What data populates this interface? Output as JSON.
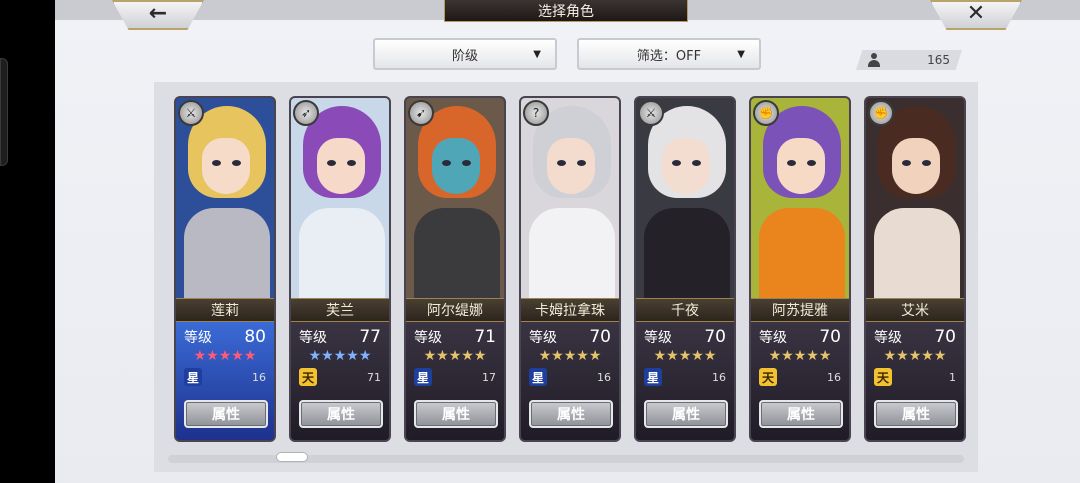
{
  "header": {
    "title": "选择角色",
    "back_icon": "←",
    "close_icon": "✕"
  },
  "filters": {
    "rank_label": "阶级",
    "filter_label": "筛选：OFF",
    "caret": "▼"
  },
  "roster_count": "165",
  "characters": [
    {
      "name": "莲莉",
      "level_label": "等级",
      "level": "80",
      "stars": "★★★★★",
      "star_color": "#ff5a78",
      "rank": "星",
      "rank_bg": "#1f3f9e",
      "rank_fg": "#ffffff",
      "rank_num": "16",
      "attr": "属性",
      "hair": "#e8c45e",
      "skin": "#f6dcc8",
      "body": "#b9b9c4",
      "bg": "#2d4f9a",
      "info_bg": "linear-gradient(#3b6bd6,#1c2f8a)"
    },
    {
      "name": "芙兰",
      "level_label": "等级",
      "level": "77",
      "stars": "★★★★★",
      "star_color": "#7fb2ff",
      "rank": "天",
      "rank_bg": "#f2c230",
      "rank_fg": "#3a2400",
      "rank_num": "71",
      "attr": "属性",
      "hair": "#8a4bb8",
      "skin": "#f6d9c9",
      "body": "#e8eef4",
      "bg": "#c8d8e8",
      "info_bg": "linear-gradient(#3a3442,#1f1b26)"
    },
    {
      "name": "阿尔缇娜",
      "level_label": "等级",
      "level": "71",
      "stars": "★★★★★",
      "star_color": "#e6c46a",
      "rank": "星",
      "rank_bg": "#1f3f9e",
      "rank_fg": "#ffffff",
      "rank_num": "17",
      "attr": "属性",
      "hair": "#d8652a",
      "skin": "#4fa6b6",
      "body": "#3b3a3c",
      "bg": "#6b5a4a",
      "info_bg": "linear-gradient(#3a3442,#1f1b26)"
    },
    {
      "name": "卡姆拉拿珠",
      "level_label": "等级",
      "level": "70",
      "stars": "★★★★★",
      "star_color": "#e6c46a",
      "rank": "星",
      "rank_bg": "#1f3f9e",
      "rank_fg": "#ffffff",
      "rank_num": "16",
      "attr": "属性",
      "hair": "#cfcfd6",
      "skin": "#f3dccd",
      "body": "#f2f2f5",
      "bg": "#d9d6dc",
      "info_bg": "linear-gradient(#3a3442,#1f1b26)"
    },
    {
      "name": "千夜",
      "level_label": "等级",
      "level": "70",
      "stars": "★★★★★",
      "star_color": "#e6c46a",
      "rank": "星",
      "rank_bg": "#1f3f9e",
      "rank_fg": "#ffffff",
      "rank_num": "16",
      "attr": "属性",
      "hair": "#e3e3e6",
      "skin": "#f2ddd0",
      "body": "#242228",
      "bg": "#3a3a42",
      "info_bg": "linear-gradient(#3a3442,#1f1b26)"
    },
    {
      "name": "阿苏提雅",
      "level_label": "等级",
      "level": "70",
      "stars": "★★★★★",
      "star_color": "#e6c46a",
      "rank": "天",
      "rank_bg": "#f2c230",
      "rank_fg": "#3a2400",
      "rank_num": "16",
      "attr": "属性",
      "hair": "#7a52b8",
      "skin": "#f6dac6",
      "body": "#e9851c",
      "bg": "#a8b43a",
      "info_bg": "linear-gradient(#3a3442,#1f1b26)"
    },
    {
      "name": "艾米",
      "level_label": "等级",
      "level": "70",
      "stars": "★★★★★",
      "star_color": "#e6c46a",
      "rank": "天",
      "rank_bg": "#f2c230",
      "rank_fg": "#3a2400",
      "rank_num": "1",
      "attr": "属性",
      "hair": "#4a2b22",
      "skin": "#f1d3bd",
      "body": "#e8dcd2",
      "bg": "#3a2f2e",
      "info_bg": "linear-gradient(#3a3442,#1f1b26)"
    }
  ],
  "type_icons": [
    "⚔",
    "➶",
    "➹",
    "?",
    "⚔",
    "✊",
    "✊"
  ]
}
